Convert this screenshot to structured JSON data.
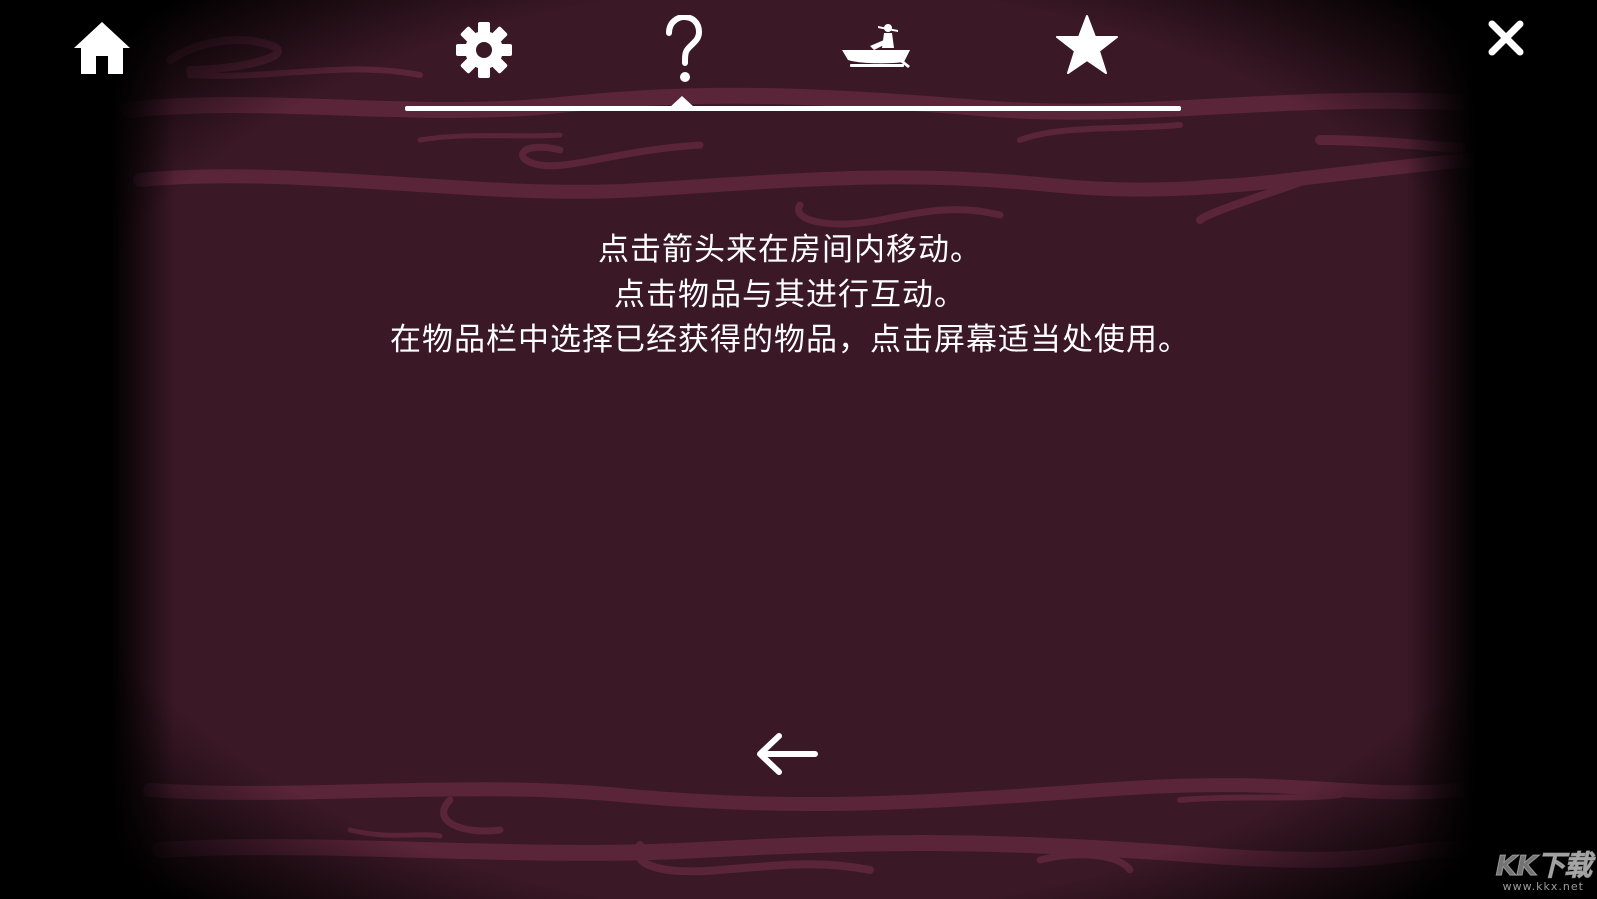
{
  "colors": {
    "background": "#3a1825",
    "swirl": "#5a2439",
    "swirl_light": "#6a2a45",
    "foreground": "#ffffff",
    "outer": "#000000"
  },
  "toolbar": {
    "home_icon": "home-icon",
    "close_icon": "close-icon",
    "tabs": [
      {
        "icon": "gear-icon",
        "name": "settings"
      },
      {
        "icon": "question-icon",
        "name": "help",
        "selected": true
      },
      {
        "icon": "boat-icon",
        "name": "boat"
      },
      {
        "icon": "star-icon",
        "name": "star"
      }
    ]
  },
  "help": {
    "lines": [
      "点击箭头来在房间内移动。",
      "点击物品与其进行互动。",
      "在物品栏中选择已经获得的物品，点击屏幕适当处使用。"
    ]
  },
  "navigation": {
    "back_icon": "arrow-left-icon"
  },
  "watermark": {
    "main": "KK下载",
    "sub": "www.kkx.net"
  }
}
